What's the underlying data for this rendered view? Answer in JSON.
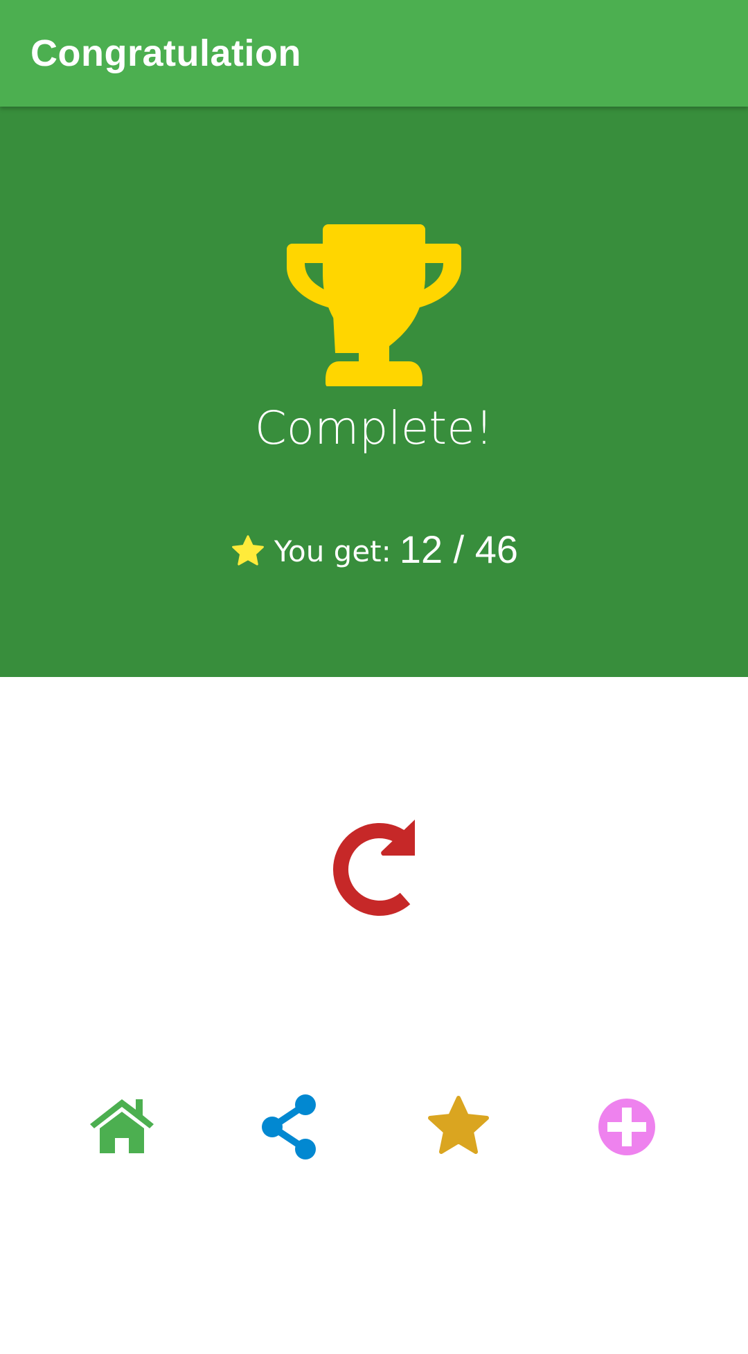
{
  "appbar": {
    "title": "Congratulation",
    "color": "#4CAF50"
  },
  "hero": {
    "background": "#388E3C",
    "trophy_icon": "trophy-icon",
    "trophy_color": "#FFD600",
    "message": "Complete!",
    "score": {
      "star_icon": "star-icon",
      "star_color": "#FFEB3B",
      "label": "You get:",
      "value": "12 / 46"
    }
  },
  "main": {
    "replay_icon": "replay-icon",
    "replay_color": "#C62828"
  },
  "actions": [
    {
      "name": "home",
      "icon": "home-icon",
      "color": "#4CAF50"
    },
    {
      "name": "share",
      "icon": "share-icon",
      "color": "#0288D1"
    },
    {
      "name": "rate",
      "icon": "star-icon",
      "color": "#DAA520"
    },
    {
      "name": "add",
      "icon": "plus-circle-icon",
      "color": "#EE82EE"
    }
  ]
}
